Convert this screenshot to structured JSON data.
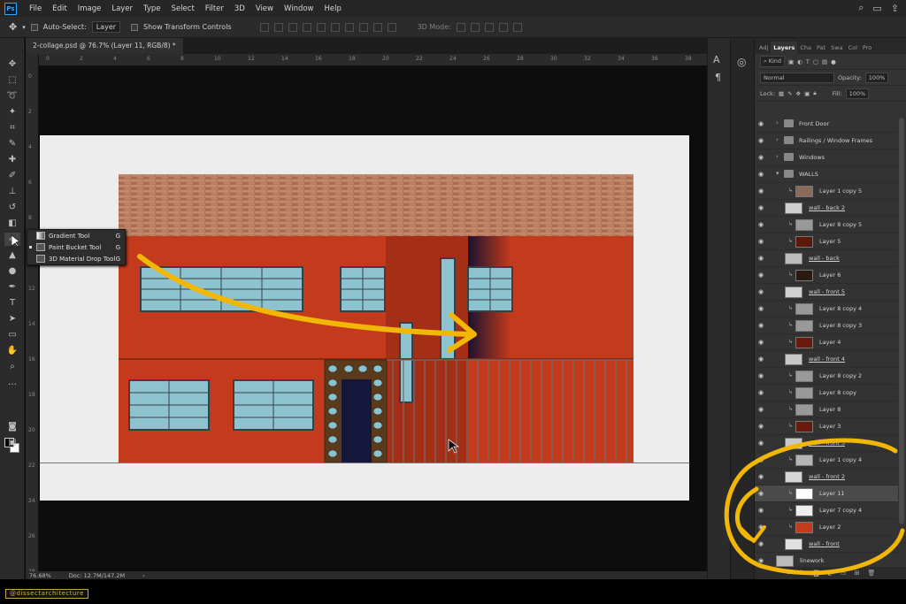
{
  "app": {
    "logo": "Ps"
  },
  "menu": [
    "File",
    "Edit",
    "Image",
    "Layer",
    "Type",
    "Select",
    "Filter",
    "3D",
    "View",
    "Window",
    "Help"
  ],
  "options": {
    "auto_select_label": "Auto-Select:",
    "auto_select_value": "Layer",
    "transform_label": "Show Transform Controls",
    "mode_3d": "3D Mode:"
  },
  "document": {
    "tab_title": "2-collage.psd @ 76.7% (Layer 11, RGB/8) *",
    "zoom": "76.68%",
    "doc_size": "Doc: 12.7M/147.2M"
  },
  "ruler_top": [
    "0",
    "2",
    "4",
    "6",
    "8",
    "10",
    "12",
    "14",
    "16",
    "18",
    "20",
    "22",
    "24",
    "26",
    "28",
    "30",
    "32",
    "34",
    "36",
    "38"
  ],
  "ruler_left": [
    "0",
    "2",
    "4",
    "6",
    "8",
    "10",
    "12",
    "14",
    "16",
    "18",
    "20",
    "22",
    "24",
    "26",
    "28"
  ],
  "flyout": [
    {
      "label": "Gradient Tool",
      "key": "G"
    },
    {
      "label": "Paint Bucket Tool",
      "key": "G"
    },
    {
      "label": "3D Material Drop Tool",
      "key": "G"
    }
  ],
  "panel": {
    "tabs": [
      "Adj",
      "Layers",
      "Cha",
      "Pat",
      "Swa",
      "Col",
      "Pro"
    ],
    "filter_kind": "Kind",
    "blend_mode": "Normal",
    "opacity_label": "Opacity:",
    "opacity_value": "100%",
    "lock_label": "Lock:",
    "fill_label": "Fill:",
    "fill_value": "100%"
  },
  "layers": [
    {
      "name": "Front Door",
      "type": "group"
    },
    {
      "name": "Railings / Window Frames",
      "type": "group"
    },
    {
      "name": "Windows",
      "type": "group"
    },
    {
      "name": "WALLS",
      "type": "group-open"
    },
    {
      "name": "Layer 1 copy 5",
      "type": "clip",
      "thumb": "#8a6a5a"
    },
    {
      "name": "wall - back 2",
      "type": "base",
      "thumb": "#cfcfcf"
    },
    {
      "name": "Layer 8 copy 5",
      "type": "clip",
      "thumb": "#999999"
    },
    {
      "name": "Layer 5",
      "type": "clip",
      "thumb": "#5a1a0a"
    },
    {
      "name": "wall - back",
      "type": "base",
      "thumb": "#bdbdbd"
    },
    {
      "name": "Layer 6",
      "type": "clip",
      "thumb": "#2a1a12"
    },
    {
      "name": "wall - front 5",
      "type": "base",
      "thumb": "#d0d0d0"
    },
    {
      "name": "Layer 8 copy 4",
      "type": "clip",
      "thumb": "#999999"
    },
    {
      "name": "Layer 8 copy 3",
      "type": "clip",
      "thumb": "#999999"
    },
    {
      "name": "Layer 4",
      "type": "clip",
      "thumb": "#6a1a0a"
    },
    {
      "name": "wall - front 4",
      "type": "base",
      "thumb": "#c8c8c8"
    },
    {
      "name": "Layer 8 copy 2",
      "type": "clip",
      "thumb": "#999999"
    },
    {
      "name": "Layer 8 copy",
      "type": "clip",
      "thumb": "#999999"
    },
    {
      "name": "Layer 8",
      "type": "clip",
      "thumb": "#999999"
    },
    {
      "name": "Layer 3",
      "type": "clip",
      "thumb": "#6a1a0a"
    },
    {
      "name": "wall - front 3",
      "type": "base",
      "thumb": "#c8c8c8"
    },
    {
      "name": "Layer 1 copy 4",
      "type": "clip",
      "thumb": "#b5b5b5"
    },
    {
      "name": "wall - front 2",
      "type": "base",
      "thumb": "#d6d6d6"
    },
    {
      "name": "Layer 11",
      "type": "clip",
      "thumb": "#ffffff",
      "selected": true
    },
    {
      "name": "Layer 7 copy 4",
      "type": "clip",
      "thumb": "#eeeeee"
    },
    {
      "name": "Layer 2",
      "type": "clip",
      "thumb": "#c43a1c"
    },
    {
      "name": "wall - front",
      "type": "base",
      "thumb": "#e0e0e0"
    },
    {
      "name": "linework",
      "type": "top",
      "thumb": "#bbbbbb"
    }
  ],
  "watermark": "@dissectarchitecture",
  "colors": {
    "accent": "#f2b705",
    "wall": "#c43a1c",
    "wall_dark": "#8f2a12",
    "glass": "#8cc3cf",
    "brick": "#b87a5e"
  }
}
